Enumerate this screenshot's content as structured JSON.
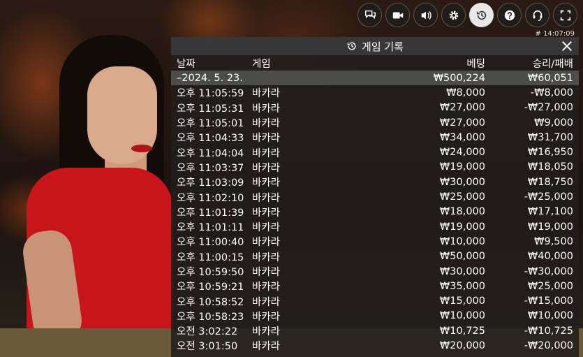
{
  "toolbar": {
    "buttons": [
      {
        "icon": "chat-icon"
      },
      {
        "icon": "video-camera-icon"
      },
      {
        "icon": "volume-icon"
      },
      {
        "icon": "gear-icon"
      },
      {
        "icon": "history-icon",
        "active": true
      },
      {
        "icon": "help-icon"
      },
      {
        "icon": "headset-icon"
      },
      {
        "icon": "fullscreen-icon"
      }
    ],
    "game_id": "# 14:07:09"
  },
  "panel": {
    "title": "게임 기록",
    "columns": {
      "date": "날짜",
      "game": "게임",
      "bet": "베팅",
      "win": "승리/패배"
    },
    "summary": {
      "date": "–2024. 5. 23.",
      "bet": "₩500,224",
      "win": "₩60,051"
    },
    "rows": [
      {
        "time": "오후 11:05:59",
        "game": "바카라",
        "bet": "₩8,000",
        "win": "-₩8,000"
      },
      {
        "time": "오후 11:05:31",
        "game": "바카라",
        "bet": "₩27,000",
        "win": "-₩27,000"
      },
      {
        "time": "오후 11:05:01",
        "game": "바카라",
        "bet": "₩27,000",
        "win": "₩9,000"
      },
      {
        "time": "오후 11:04:33",
        "game": "바카라",
        "bet": "₩34,000",
        "win": "₩31,700"
      },
      {
        "time": "오후 11:04:04",
        "game": "바카라",
        "bet": "₩24,000",
        "win": "₩16,950"
      },
      {
        "time": "오후 11:03:37",
        "game": "바카라",
        "bet": "₩19,000",
        "win": "₩18,050"
      },
      {
        "time": "오후 11:03:09",
        "game": "바카라",
        "bet": "₩30,000",
        "win": "₩18,750"
      },
      {
        "time": "오후 11:02:10",
        "game": "바카라",
        "bet": "₩25,000",
        "win": "-₩25,000"
      },
      {
        "time": "오후 11:01:39",
        "game": "바카라",
        "bet": "₩18,000",
        "win": "₩17,100"
      },
      {
        "time": "오후 11:01:11",
        "game": "바카라",
        "bet": "₩19,000",
        "win": "₩19,000"
      },
      {
        "time": "오후 11:00:40",
        "game": "바카라",
        "bet": "₩10,000",
        "win": "₩9,500"
      },
      {
        "time": "오후 11:00:15",
        "game": "바카라",
        "bet": "₩50,000",
        "win": "₩40,000"
      },
      {
        "time": "오후 10:59:50",
        "game": "바카라",
        "bet": "₩30,000",
        "win": "-₩30,000"
      },
      {
        "time": "오후 10:59:21",
        "game": "바카라",
        "bet": "₩35,000",
        "win": "₩25,000"
      },
      {
        "time": "오후 10:58:52",
        "game": "바카라",
        "bet": "₩15,000",
        "win": "-₩15,000"
      },
      {
        "time": "오후 10:58:23",
        "game": "바카라",
        "bet": "₩10,000",
        "win": "₩10,000"
      },
      {
        "time": "오전 3:02:22",
        "game": "바카라",
        "bet": "₩10,725",
        "win": "-₩10,725"
      },
      {
        "time": "오전 3:01:50",
        "game": "바카라",
        "bet": "₩20,000",
        "win": "-₩20,000"
      }
    ]
  }
}
